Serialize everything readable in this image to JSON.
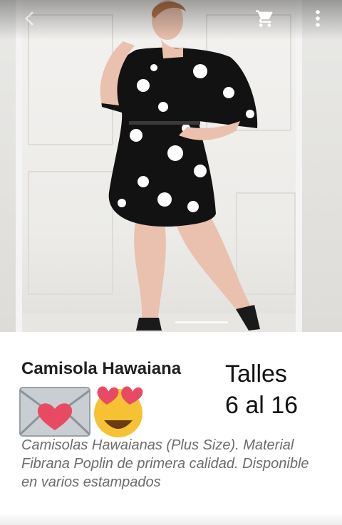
{
  "toolbar": {
    "back_icon": "chevron-left-icon",
    "cart_icon": "cart-icon",
    "menu_icon": "more-vertical-icon"
  },
  "product": {
    "title": "Camisola Hawaiana",
    "sizes_line1": "Talles",
    "sizes_line2": "6 al 16",
    "emojis": [
      "love-letter-icon",
      "heart-eyes-icon"
    ],
    "description": "Camisolas Hawaianas (Plus Size). Material Fibrana Poplin de primera calidad. Disponible en varios estampados"
  },
  "colors": {
    "accent_heart": "#e84a63",
    "emoji_yellow": "#f6c234"
  }
}
